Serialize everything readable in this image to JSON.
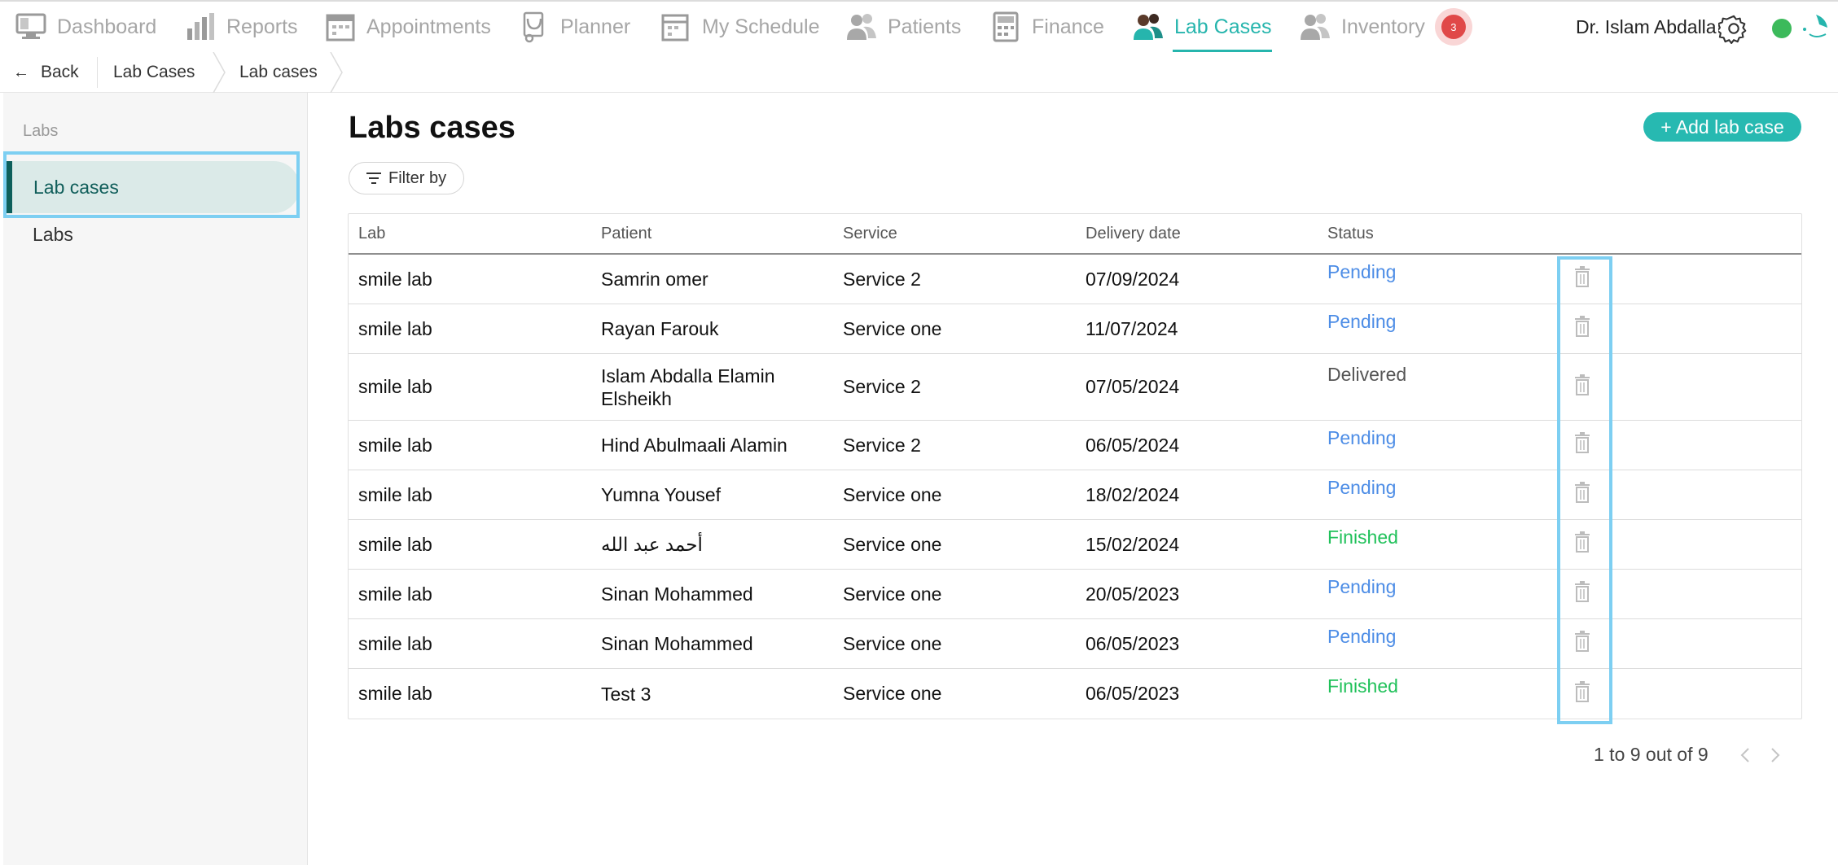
{
  "nav": {
    "items": [
      {
        "label": "Dashboard",
        "icon": "monitor-icon"
      },
      {
        "label": "Reports",
        "icon": "bar-chart-icon"
      },
      {
        "label": "Appointments",
        "icon": "calendar-icon"
      },
      {
        "label": "Planner",
        "icon": "stethoscope-icon"
      },
      {
        "label": "My Schedule",
        "icon": "schedule-icon"
      },
      {
        "label": "Patients",
        "icon": "people-icon"
      },
      {
        "label": "Finance",
        "icon": "calculator-icon"
      },
      {
        "label": "Lab Cases",
        "icon": "lab-cases-icon"
      },
      {
        "label": "Inventory",
        "icon": "inventory-icon"
      }
    ],
    "inventory_badge": "3",
    "user_name": "Dr. Islam Abdalla",
    "accent_color": "#26b5ad"
  },
  "breadcrumb": {
    "back": "Back",
    "items": [
      "Lab Cases",
      "Lab cases"
    ]
  },
  "sidebar": {
    "heading": "Labs",
    "items": [
      {
        "label": "Lab cases"
      },
      {
        "label": "Labs"
      }
    ]
  },
  "main": {
    "title": "Labs cases",
    "add_button": "+ Add lab case",
    "filter_button": "Filter by",
    "table": {
      "headers": [
        "Lab",
        "Patient",
        "Service",
        "Delivery date",
        "Status"
      ],
      "rows": [
        {
          "lab": "smile lab",
          "patient": "Samrin omer",
          "service": "Service 2",
          "date": "07/09/2024",
          "status": "Pending"
        },
        {
          "lab": "smile lab",
          "patient": "Rayan Farouk",
          "service": "Service one",
          "date": "11/07/2024",
          "status": "Pending"
        },
        {
          "lab": "smile lab",
          "patient": "Islam Abdalla Elamin Elsheikh",
          "service": "Service 2",
          "date": "07/05/2024",
          "status": "Delivered"
        },
        {
          "lab": "smile lab",
          "patient": "Hind Abulmaali Alamin",
          "service": "Service 2",
          "date": "06/05/2024",
          "status": "Pending"
        },
        {
          "lab": "smile lab",
          "patient": "Yumna Yousef",
          "service": "Service one",
          "date": "18/02/2024",
          "status": "Pending"
        },
        {
          "lab": "smile lab",
          "patient": "أحمد عبد الله",
          "service": "Service one",
          "date": "15/02/2024",
          "status": "Finished"
        },
        {
          "lab": "smile lab",
          "patient": "Sinan Mohammed",
          "service": "Service one",
          "date": "20/05/2023",
          "status": "Pending"
        },
        {
          "lab": "smile lab",
          "patient": "Sinan Mohammed",
          "service": "Service one",
          "date": "06/05/2023",
          "status": "Pending"
        },
        {
          "lab": "smile lab",
          "patient": "Test 3",
          "service": "Service one",
          "date": "06/05/2023",
          "status": "Finished"
        }
      ]
    },
    "pagination": "1 to 9 out of 9",
    "status_colors": {
      "Pending": "#4d8de6",
      "Finished": "#20c15a",
      "Delivered": "#555555"
    }
  }
}
